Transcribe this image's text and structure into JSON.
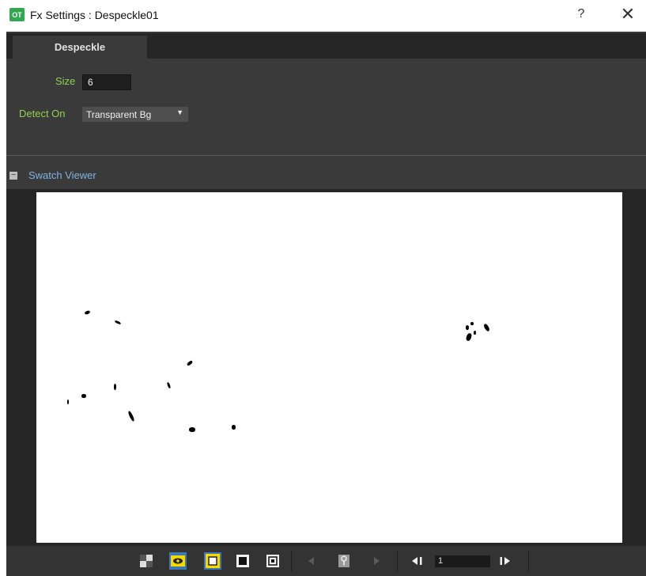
{
  "window": {
    "app_icon_text": "OT",
    "title": "Fx Settings : Despeckle01",
    "help_label": "?",
    "close_label": "✕"
  },
  "tabs": [
    {
      "label": "Despeckle",
      "active": true
    }
  ],
  "params": {
    "size_label": "Size",
    "size_value": "6",
    "detect_label": "Detect On",
    "detect_value": "Transparent Bg"
  },
  "swatch_section": {
    "title": "Swatch Viewer",
    "collapse_symbol": "−"
  },
  "toolbar": {
    "buttons": [
      {
        "name": "checkerboard-icon",
        "active": false
      },
      {
        "name": "eye-icon",
        "active": true
      },
      {
        "name": "white-bg-icon",
        "active": true
      },
      {
        "name": "black-bg-icon",
        "active": false
      },
      {
        "name": "preview-icon",
        "active": false
      },
      {
        "name": "prev-key-icon",
        "active": false
      },
      {
        "name": "key-icon",
        "active": false
      },
      {
        "name": "next-key-icon",
        "active": false
      },
      {
        "name": "prev-frame-icon",
        "active": false
      },
      {
        "name": "next-frame-icon",
        "active": false
      }
    ],
    "frame_value": "1"
  },
  "colors": {
    "panel_bg": "#3a3a3a",
    "label_green": "#8fd14f",
    "section_blue": "#7fb2e0",
    "active_blue": "#3d78b5",
    "highlight_yellow": "#f5d800"
  }
}
